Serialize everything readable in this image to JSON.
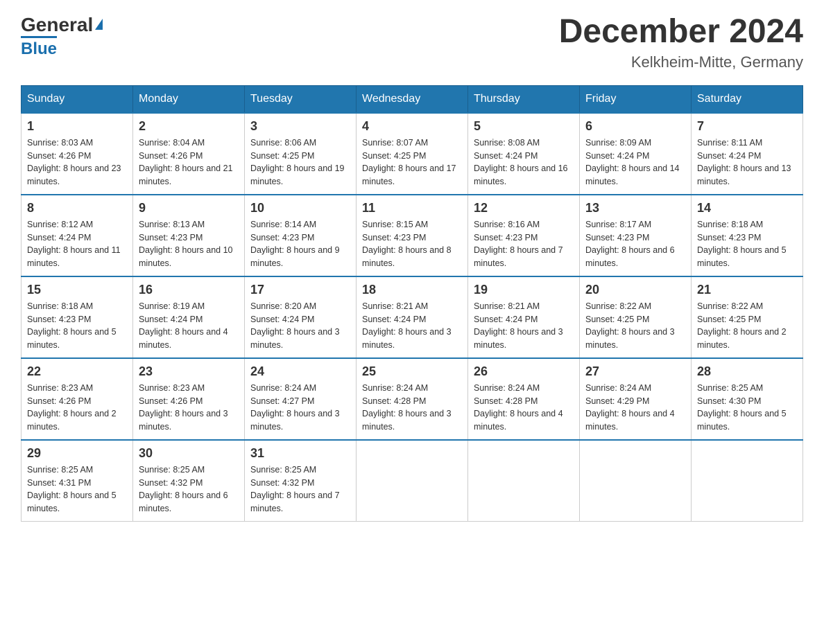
{
  "header": {
    "logo_general": "General",
    "logo_blue": "Blue",
    "month_title": "December 2024",
    "location": "Kelkheim-Mitte, Germany"
  },
  "weekdays": [
    "Sunday",
    "Monday",
    "Tuesday",
    "Wednesday",
    "Thursday",
    "Friday",
    "Saturday"
  ],
  "weeks": [
    [
      {
        "day": "1",
        "sunrise": "8:03 AM",
        "sunset": "4:26 PM",
        "daylight": "8 hours and 23 minutes."
      },
      {
        "day": "2",
        "sunrise": "8:04 AM",
        "sunset": "4:26 PM",
        "daylight": "8 hours and 21 minutes."
      },
      {
        "day": "3",
        "sunrise": "8:06 AM",
        "sunset": "4:25 PM",
        "daylight": "8 hours and 19 minutes."
      },
      {
        "day": "4",
        "sunrise": "8:07 AM",
        "sunset": "4:25 PM",
        "daylight": "8 hours and 17 minutes."
      },
      {
        "day": "5",
        "sunrise": "8:08 AM",
        "sunset": "4:24 PM",
        "daylight": "8 hours and 16 minutes."
      },
      {
        "day": "6",
        "sunrise": "8:09 AM",
        "sunset": "4:24 PM",
        "daylight": "8 hours and 14 minutes."
      },
      {
        "day": "7",
        "sunrise": "8:11 AM",
        "sunset": "4:24 PM",
        "daylight": "8 hours and 13 minutes."
      }
    ],
    [
      {
        "day": "8",
        "sunrise": "8:12 AM",
        "sunset": "4:24 PM",
        "daylight": "8 hours and 11 minutes."
      },
      {
        "day": "9",
        "sunrise": "8:13 AM",
        "sunset": "4:23 PM",
        "daylight": "8 hours and 10 minutes."
      },
      {
        "day": "10",
        "sunrise": "8:14 AM",
        "sunset": "4:23 PM",
        "daylight": "8 hours and 9 minutes."
      },
      {
        "day": "11",
        "sunrise": "8:15 AM",
        "sunset": "4:23 PM",
        "daylight": "8 hours and 8 minutes."
      },
      {
        "day": "12",
        "sunrise": "8:16 AM",
        "sunset": "4:23 PM",
        "daylight": "8 hours and 7 minutes."
      },
      {
        "day": "13",
        "sunrise": "8:17 AM",
        "sunset": "4:23 PM",
        "daylight": "8 hours and 6 minutes."
      },
      {
        "day": "14",
        "sunrise": "8:18 AM",
        "sunset": "4:23 PM",
        "daylight": "8 hours and 5 minutes."
      }
    ],
    [
      {
        "day": "15",
        "sunrise": "8:18 AM",
        "sunset": "4:23 PM",
        "daylight": "8 hours and 5 minutes."
      },
      {
        "day": "16",
        "sunrise": "8:19 AM",
        "sunset": "4:24 PM",
        "daylight": "8 hours and 4 minutes."
      },
      {
        "day": "17",
        "sunrise": "8:20 AM",
        "sunset": "4:24 PM",
        "daylight": "8 hours and 3 minutes."
      },
      {
        "day": "18",
        "sunrise": "8:21 AM",
        "sunset": "4:24 PM",
        "daylight": "8 hours and 3 minutes."
      },
      {
        "day": "19",
        "sunrise": "8:21 AM",
        "sunset": "4:24 PM",
        "daylight": "8 hours and 3 minutes."
      },
      {
        "day": "20",
        "sunrise": "8:22 AM",
        "sunset": "4:25 PM",
        "daylight": "8 hours and 3 minutes."
      },
      {
        "day": "21",
        "sunrise": "8:22 AM",
        "sunset": "4:25 PM",
        "daylight": "8 hours and 2 minutes."
      }
    ],
    [
      {
        "day": "22",
        "sunrise": "8:23 AM",
        "sunset": "4:26 PM",
        "daylight": "8 hours and 2 minutes."
      },
      {
        "day": "23",
        "sunrise": "8:23 AM",
        "sunset": "4:26 PM",
        "daylight": "8 hours and 3 minutes."
      },
      {
        "day": "24",
        "sunrise": "8:24 AM",
        "sunset": "4:27 PM",
        "daylight": "8 hours and 3 minutes."
      },
      {
        "day": "25",
        "sunrise": "8:24 AM",
        "sunset": "4:28 PM",
        "daylight": "8 hours and 3 minutes."
      },
      {
        "day": "26",
        "sunrise": "8:24 AM",
        "sunset": "4:28 PM",
        "daylight": "8 hours and 4 minutes."
      },
      {
        "day": "27",
        "sunrise": "8:24 AM",
        "sunset": "4:29 PM",
        "daylight": "8 hours and 4 minutes."
      },
      {
        "day": "28",
        "sunrise": "8:25 AM",
        "sunset": "4:30 PM",
        "daylight": "8 hours and 5 minutes."
      }
    ],
    [
      {
        "day": "29",
        "sunrise": "8:25 AM",
        "sunset": "4:31 PM",
        "daylight": "8 hours and 5 minutes."
      },
      {
        "day": "30",
        "sunrise": "8:25 AM",
        "sunset": "4:32 PM",
        "daylight": "8 hours and 6 minutes."
      },
      {
        "day": "31",
        "sunrise": "8:25 AM",
        "sunset": "4:32 PM",
        "daylight": "8 hours and 7 minutes."
      },
      null,
      null,
      null,
      null
    ]
  ]
}
